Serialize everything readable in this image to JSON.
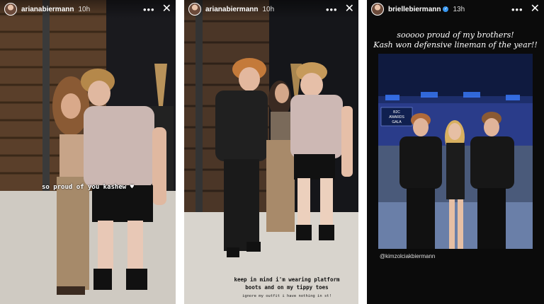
{
  "story1": {
    "username": "arianabiermann",
    "time": "10h",
    "caption": "so proud of you kashew ♥"
  },
  "story2": {
    "username": "arianabiermann",
    "time": "10h",
    "caption_main": "keep in mind i'm wearing platform boots and on my tippy toes",
    "caption_small": "ignore my outfit i have nothing in st!"
  },
  "story3": {
    "username": "briellebiermann",
    "verified": true,
    "time": "13h",
    "text_line1": "sooooo proud of my brothers!",
    "text_line2": "Kash won defensive lineman of the year!!",
    "banner_line1": "B2C",
    "banner_line2": "AWARDS",
    "banner_line3": "GALA",
    "mention": "@kimzolciakbiermann"
  },
  "icons": {
    "more": "more-horizontal-icon",
    "close": "close-icon",
    "verified": "verified-badge-icon"
  },
  "colors": {
    "verified_blue": "#3897f0",
    "story3_bg": "#0b0b0b"
  }
}
